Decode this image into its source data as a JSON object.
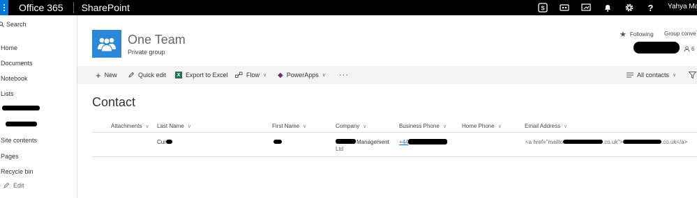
{
  "suitebar": {
    "brand": "Office 365",
    "app": "SharePoint",
    "user": "Yahya Mar",
    "icons": [
      "skype-icon",
      "video-icon",
      "presentation-icon",
      "bell-icon",
      "gear-icon",
      "help-icon"
    ],
    "help_glyph": "?"
  },
  "leftnav": {
    "search": "Search",
    "items": [
      "Home",
      "Documents",
      "Notebook",
      "Lists"
    ],
    "items2": [
      "Site contents",
      "Pages",
      "Recycle bin"
    ],
    "edit": "Edit"
  },
  "site": {
    "title": "One Team",
    "subtitle": "Private group",
    "following": "Following",
    "group_conv": "Group conve",
    "members_count": "6"
  },
  "commands": {
    "new": "New",
    "quick_edit": "Quick edit",
    "export": "Export to Excel",
    "flow": "Flow",
    "powerapps": "PowerApps",
    "more": "···",
    "view": "All contacts"
  },
  "list": {
    "title": "Contact",
    "columns": [
      "Attachments",
      "Last Name",
      "First Name",
      "Company",
      "Business Phone",
      "Home Phone",
      "Email Address"
    ],
    "row": {
      "last_name": "Cur",
      "company_suffix": "Management",
      "company_line2": "Ltd",
      "phone_prefix": "+44",
      "email_a": "<a href=\"mailto:",
      "email_b": ".co.uk\">",
      "email_c": ".co.uk</a>"
    }
  },
  "colors": {
    "suitebar": "#000000",
    "accent": "#0078d7",
    "site_logo": "#2b88d8",
    "excel": "#217346",
    "powerapps": "#742774"
  }
}
